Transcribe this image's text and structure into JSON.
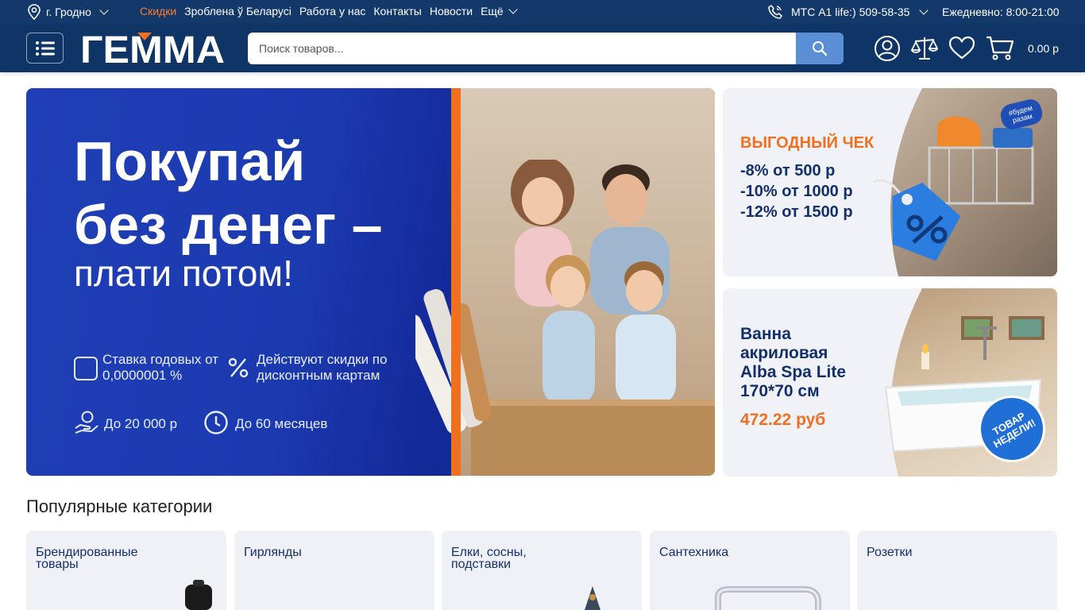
{
  "topbar": {
    "city": "г. Гродно",
    "nav": [
      {
        "label": "Скидки",
        "active": true
      },
      {
        "label": "Зроблена ў Беларусі",
        "active": false
      },
      {
        "label": "Работа у нас",
        "active": false
      },
      {
        "label": "Контакты",
        "active": false
      },
      {
        "label": "Новости",
        "active": false
      }
    ],
    "more_label": "Ещё",
    "phone": "МТС A1 life:) 509-58-35",
    "hours": "Ежедневно: 8:00-21:00"
  },
  "header": {
    "logo_text": "ГЕММА",
    "search_placeholder": "Поиск товаров...",
    "cart_total": "0.00 р"
  },
  "banner_main": {
    "headline": "Покупай без денег –",
    "subheadline": "плати потом!",
    "features": {
      "rate": "Ставка годовых от 0,0000001 %",
      "discount": "Действуют скидки по дисконтным картам",
      "amount": "До 20 000 р",
      "term": "До 60 месяцев"
    }
  },
  "banner_check": {
    "title": "ВЫГОДНЫЙ ЧЕК",
    "lines": [
      "-8% от 500 р",
      "-10% от 1000 р",
      "-12% от 1500 р"
    ],
    "badge": "#будем разам"
  },
  "banner_product": {
    "title": "Ванна акриловая Alba Spa Lite 170*70 см",
    "price": "472.22 руб",
    "badge": "ТОВАР НЕДЕЛИ!"
  },
  "popular": {
    "title": "Популярные категории",
    "items": [
      {
        "label": "Брендированные товары"
      },
      {
        "label": "Гирлянды"
      },
      {
        "label": "Елки, сосны, подставки"
      },
      {
        "label": "Сантехника"
      },
      {
        "label": "Розетки"
      }
    ]
  },
  "colors": {
    "topbar_bg": "#13396b",
    "header_bg": "#0f3566",
    "accent_orange": "#f07020",
    "search_button": "#5a8fd6",
    "navy_text": "#13306b"
  },
  "icons": [
    "map-pin-icon",
    "phone-icon",
    "menu-list-icon",
    "search-icon",
    "user-icon",
    "compare-scales-icon",
    "heart-icon",
    "cart-icon"
  ]
}
